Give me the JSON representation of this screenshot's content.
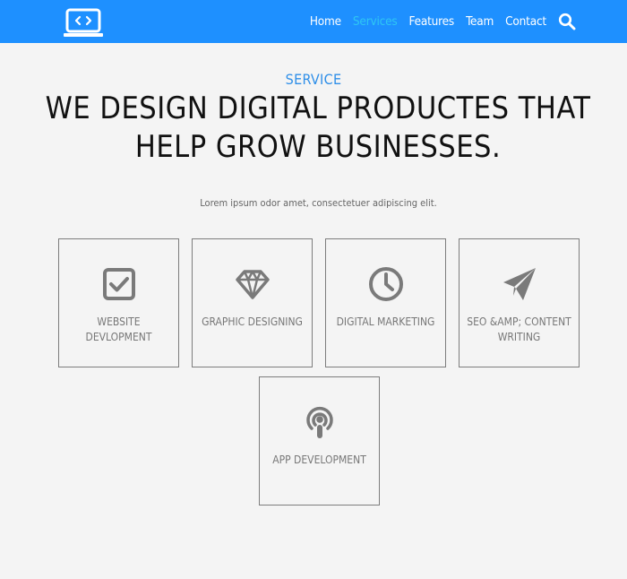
{
  "nav": {
    "logo_icon": "code-laptop-icon",
    "links": [
      {
        "label": "Home",
        "active": false
      },
      {
        "label": "Services",
        "active": true
      },
      {
        "label": "Features",
        "active": false
      },
      {
        "label": "Team",
        "active": false
      },
      {
        "label": "Contact",
        "active": false
      }
    ],
    "search_icon": "search-icon"
  },
  "hero": {
    "section_label": "SERVICE",
    "headline": "WE DESIGN DIGITAL PRODUCTES THAT HELP GROW BUSINESSES.",
    "tagline": "Lorem ipsum odor amet, consectetuer adipiscing elit."
  },
  "services": [
    {
      "label": "WEBSITE DEVLOPMENT",
      "icon": "checkbox-icon"
    },
    {
      "label": "GRAPHIC DESIGNING",
      "icon": "diamond-icon"
    },
    {
      "label": "DIGITAL MARKETING",
      "icon": "clock-icon"
    },
    {
      "label": "SEO &AMP; CONTENT WRITING",
      "icon": "paper-plane-icon"
    },
    {
      "label": "APP DEVELOPMENT",
      "icon": "podcast-icon"
    }
  ],
  "colors": {
    "nav_background": "#1e90ff",
    "active_link": "#2ec7f3",
    "accent": "#2f8fe8",
    "page_background": "#f4f4f4",
    "card_border": "#7d7d7d",
    "icon_gray": "#7a7a7a"
  }
}
